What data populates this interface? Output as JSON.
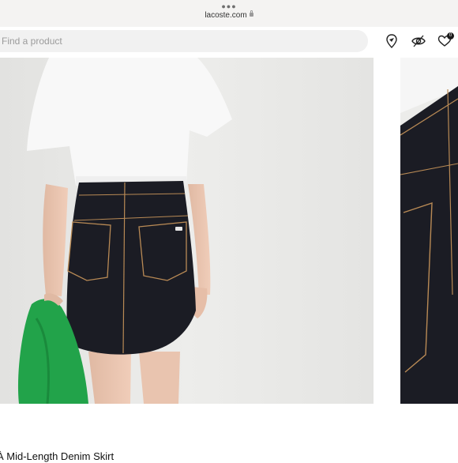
{
  "browser": {
    "dots_icon": "more-dots-icon",
    "url": "lacoste.com",
    "lock_icon": "lock-icon"
  },
  "header": {
    "search_placeholder": "Find a product",
    "icons": [
      "store-locator-pin-icon",
      "eye-view-icon",
      "heart-wishlist-icon"
    ],
    "wishlist_count": "0"
  },
  "gallery": {
    "images": [
      {
        "subject": "back-view-model-denim-skirt-photo"
      },
      {
        "subject": "close-up-denim-pocket-photo"
      }
    ]
  },
  "product": {
    "name": "À Mid-Length Denim Skirt"
  },
  "colors": {
    "denim": "#1b1c24",
    "stitch": "#b98a55",
    "tshirt": "#f7f7f7",
    "jacket": "#22a34a",
    "background": "#e9e9e7"
  }
}
